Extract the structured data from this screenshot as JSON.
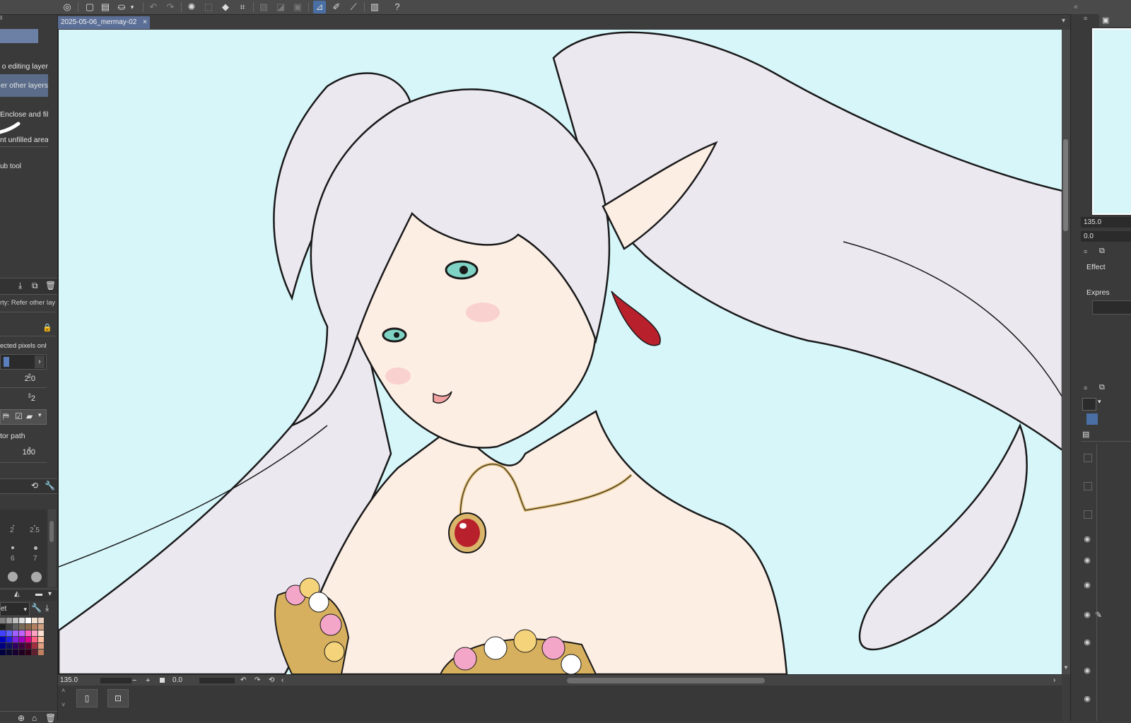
{
  "document": {
    "tab_title": "2025-05-06_mermay-02",
    "close_glyph": "×"
  },
  "left_panel": {
    "tool_options": [
      "o editing layer",
      "er other layers",
      "Enclose and fill",
      "nt unfilled area",
      "ub tool"
    ],
    "property_label": "rty: Refer other lay",
    "selected_pixels_label": "ected pixels only",
    "value_1": "2.0",
    "value_2": "2",
    "vector_path_label": "tor path",
    "opacity_value": "100",
    "brush_sizes": [
      "2",
      "2.5",
      "6",
      "7"
    ],
    "set_label": "et"
  },
  "status": {
    "zoom": "135.0",
    "rotation": "0.0",
    "minus": "−",
    "plus": "+"
  },
  "right_panel": {
    "nav_zoom": "135.0",
    "nav_rotation": "0.0",
    "effect_label": "Effect",
    "expression_label": "Expres"
  },
  "icons": {
    "undo": "↶",
    "redo": "↷",
    "help": "?",
    "close": "×",
    "eye": "👁",
    "pencil": "✎"
  },
  "colors": {
    "canvas_bg": "#d6f6fa",
    "hair": "#ebe8f0",
    "skin": "#fdeee4",
    "accent_tab": "#5b6f96",
    "earring": "#b8202c",
    "necklace": "#d9b66a"
  }
}
